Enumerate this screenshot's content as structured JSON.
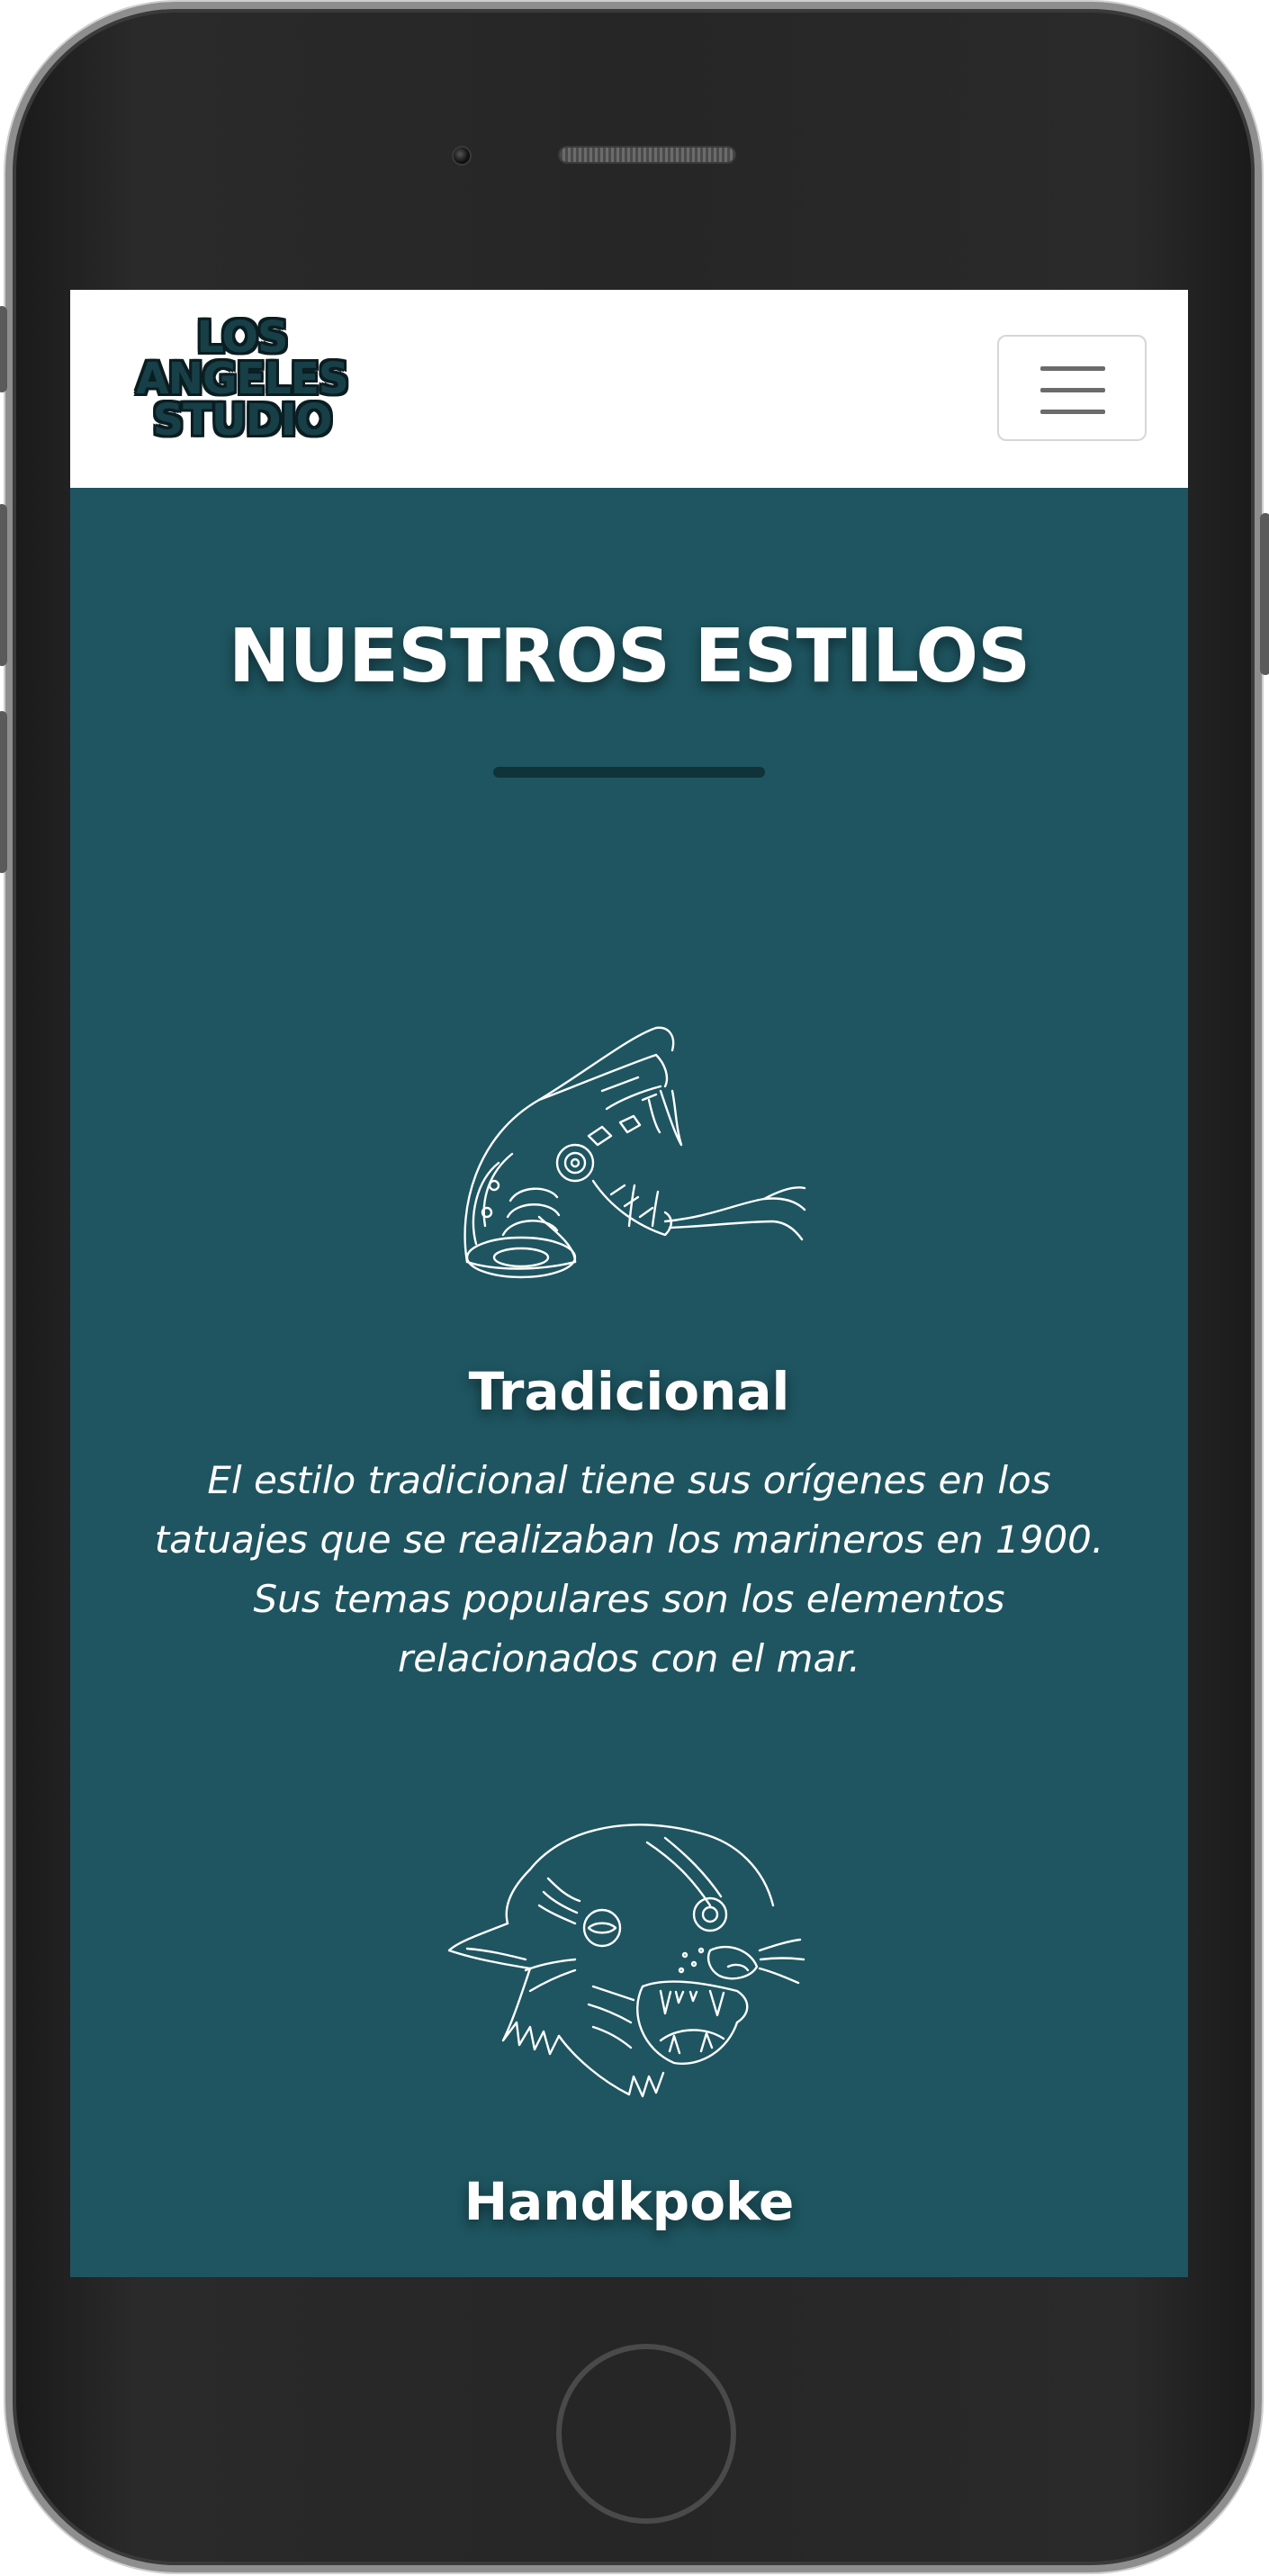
{
  "brand": {
    "logo_line1": "LOS",
    "logo_line2": "ANGELES",
    "logo_line3": "STUDIO",
    "logo_color": "#173f47"
  },
  "navbar": {
    "toggler_icon": "hamburger-menu-icon"
  },
  "section": {
    "title": "NUESTROS ESTILOS",
    "background": "#1e5560"
  },
  "styles": [
    {
      "icon": "snake-head-icon",
      "name": "Tradicional",
      "description": "El estilo tradicional tiene sus orígenes en los tatuajes que se realizaban los marineros en 1900. Sus temas populares son los elementos relacionados con el mar."
    },
    {
      "icon": "panther-head-icon",
      "name": "Handkpoke"
    }
  ]
}
